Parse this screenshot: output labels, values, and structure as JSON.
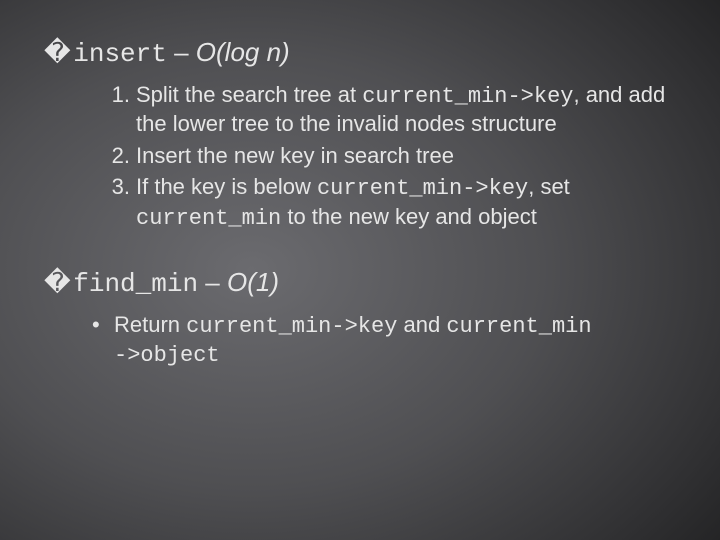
{
  "bullet_char": "�",
  "sections": {
    "insert": {
      "name": "insert",
      "sep": " – ",
      "complexity": "O(log n)",
      "items": [
        {
          "pre": "Split the search tree at ",
          "code1": "current_min->key",
          "mid": ", and add the lower tree to the invalid nodes structure"
        },
        {
          "pre": "Insert the new key in search tree"
        },
        {
          "pre": "If the key is below ",
          "code1": "current_min->key",
          "mid": ", set ",
          "code2": "current_min",
          "post": " to the new key and object"
        }
      ]
    },
    "find_min": {
      "name": "find_min",
      "sep": " – ",
      "complexity": "O(1)",
      "items": [
        {
          "pre": "Return ",
          "code1": "current_min->key",
          "mid": " and ",
          "code2": "current_min\n->object"
        }
      ]
    }
  }
}
